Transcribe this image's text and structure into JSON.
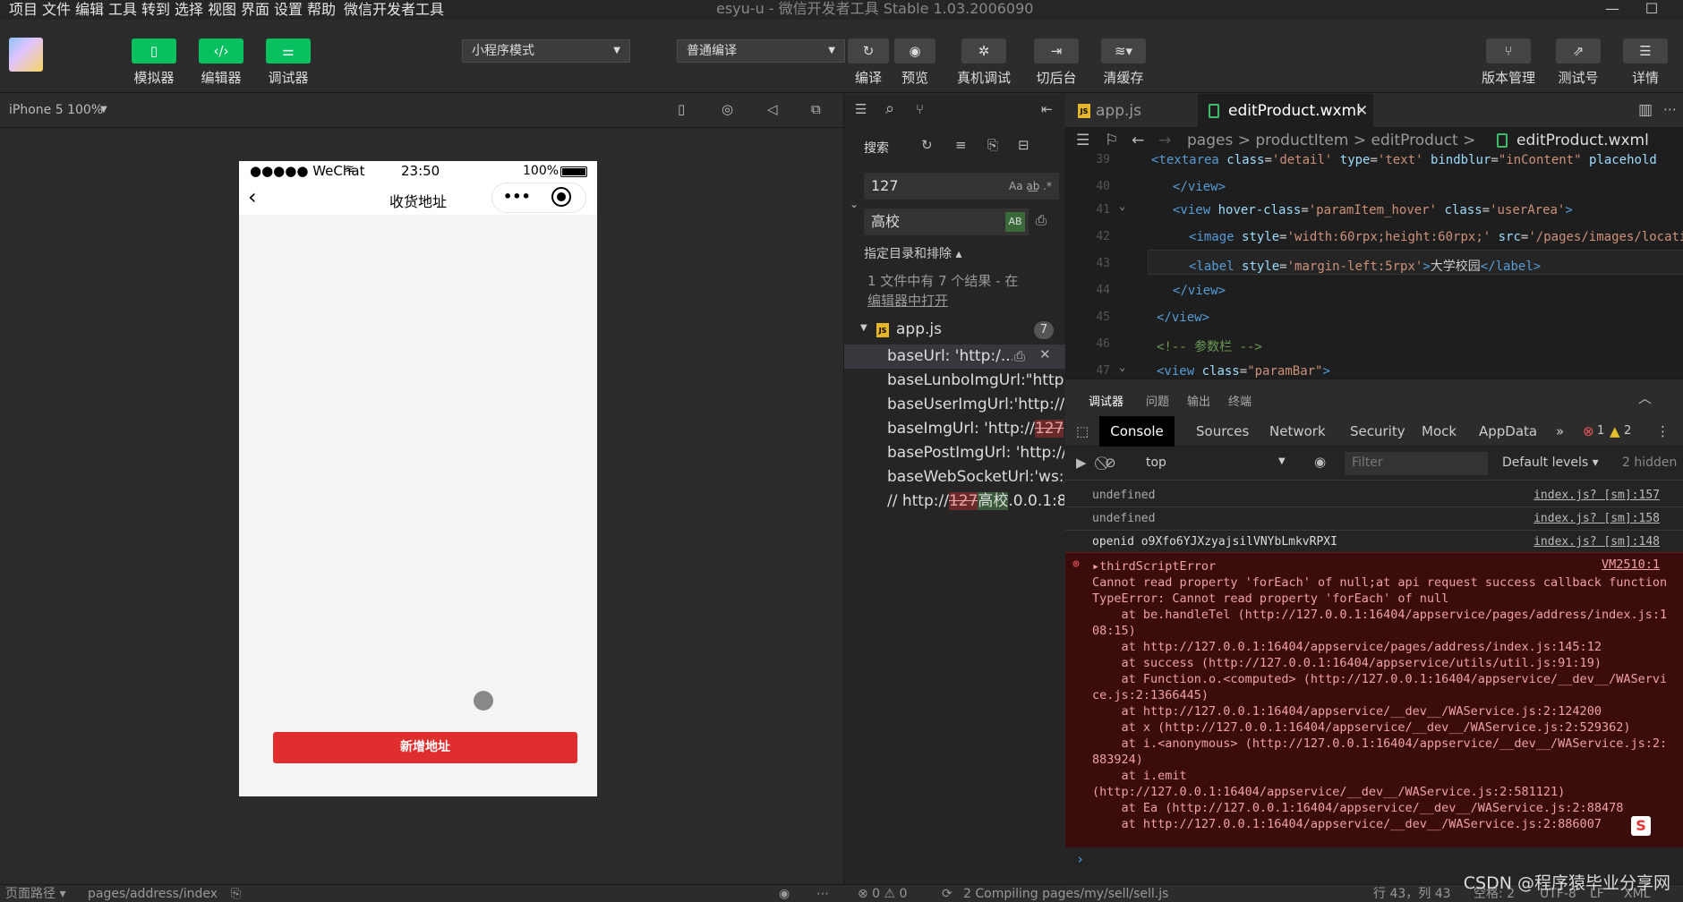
{
  "menu": [
    "项目",
    "文件",
    "编辑",
    "工具",
    "转到",
    "选择",
    "视图",
    "界面",
    "设置",
    "帮助",
    "微信开发者工具"
  ],
  "window_title": "esyu-u - 微信开发者工具 Stable 1.03.2006090",
  "toolbar": {
    "simulator": "模拟器",
    "editor": "编辑器",
    "debugger": "调试器",
    "mode": "小程序模式",
    "compile_mode": "普通编译",
    "compile": "编译",
    "preview": "预览",
    "real_debug": "真机调试",
    "background": "切后台",
    "clear_cache": "清缓存",
    "version": "版本管理",
    "test": "测试号",
    "details": "详情"
  },
  "simulator": {
    "device": "iPhone 5 100%",
    "status": {
      "carrier": "●●●●● WeChat",
      "time": "23:50",
      "battery": "100%"
    },
    "nav_title": "收货地址",
    "add_button": "新增地址"
  },
  "search": {
    "title": "搜索",
    "query": "127",
    "replace": "高校",
    "include_toggle": "指定目录和排除 ▴",
    "summary": "1 文件中有 7 个结果 - 在",
    "open_link": "编辑器中打开",
    "file": "app.js",
    "count": "7",
    "results": [
      {
        "pre": "baseUrl: 'http:/...",
        "hit": "",
        "post": ""
      },
      {
        "pre": "baseLunboImgUrl:\"http:...",
        "hit": "",
        "post": ""
      },
      {
        "pre": "baseUserImgUrl:'http://...",
        "hit": "",
        "post": ""
      },
      {
        "pre": "baseImgUrl: 'http://",
        "hit": "127",
        "post": "..."
      },
      {
        "pre": "basePostImgUrl: 'http://...",
        "hit": "",
        "post": ""
      },
      {
        "pre": "baseWebSocketUrl:'ws:/...",
        "hit": "",
        "post": ""
      },
      {
        "pre": "// http://",
        "hit": "127",
        "post": ".0.0.1:8...",
        "rep": "高校"
      }
    ]
  },
  "editor": {
    "tab1": "app.js",
    "tab2": "editProduct.wxml",
    "breadcrumb": "pages > productItem > editProduct > ",
    "breadcrumb_file": "editProduct.wxml",
    "lines": [
      "39",
      "40",
      "41",
      "42",
      "43",
      "44",
      "45",
      "46",
      "47"
    ]
  },
  "debugger": {
    "tabs": [
      "调试器",
      "问题",
      "输出",
      "终端"
    ],
    "devtools": [
      "Console",
      "Sources",
      "Network",
      "Security",
      "Mock",
      "AppData"
    ],
    "err_count": "1",
    "warn_count": "2",
    "context": "top",
    "filter_placeholder": "Filter",
    "levels": "Default levels ▾",
    "hidden": "2 hidden",
    "logs": [
      {
        "msg": "undefined",
        "src": "index.js? [sm]:157"
      },
      {
        "msg": "undefined",
        "src": "index.js? [sm]:158"
      },
      {
        "msg": "openid o9Xfo6YJXzyajsilVNYbLmkvRPXI",
        "src": "index.js? [sm]:148"
      }
    ],
    "error_src": "VM2510:1",
    "error_title": "▸thirdScriptError",
    "error_text": "Cannot read property 'forEach' of null;at api request success callback function\nTypeError: Cannot read property 'forEach' of null\n    at be.handleTel (http://127.0.0.1:16404/appservice/pages/address/index.js:108:15)\n    at http://127.0.0.1:16404/appservice/pages/address/index.js:145:12\n    at success (http://127.0.0.1:16404/appservice/utils/util.js:91:19)\n    at Function.o.<computed> (http://127.0.0.1:16404/appservice/__dev__/WAService.js:2:1366445)\n    at http://127.0.0.1:16404/appservice/__dev__/WAService.js:2:124200\n    at x (http://127.0.0.1:16404/appservice/__dev__/WAService.js:2:529362)\n    at i.<anonymous> (http://127.0.0.1:16404/appservice/__dev__/WAService.js:2:883924)\n    at i.emit\n(http://127.0.0.1:16404/appservice/__dev__/WAService.js:2:581121)\n    at Ea (http://127.0.0.1:16404/appservice/__dev__/WAService.js:2:88478\n    at http://127.0.0.1:16404/appservice/__dev__/WAService.js:2:886007"
  },
  "statusbar": {
    "path_label": "页面路径 ▾",
    "path": "pages/address/index",
    "problems": "⊗ 0 ⚠ 0",
    "compiling": "2 Compiling pages/my/sell/sell.js",
    "cursor": "行 43，列 43",
    "spaces": "空格: 2",
    "encoding": "UTF-8",
    "eol": "LF",
    "lang": "XML"
  },
  "watermark": "CSDN @程序猿毕业分享网"
}
